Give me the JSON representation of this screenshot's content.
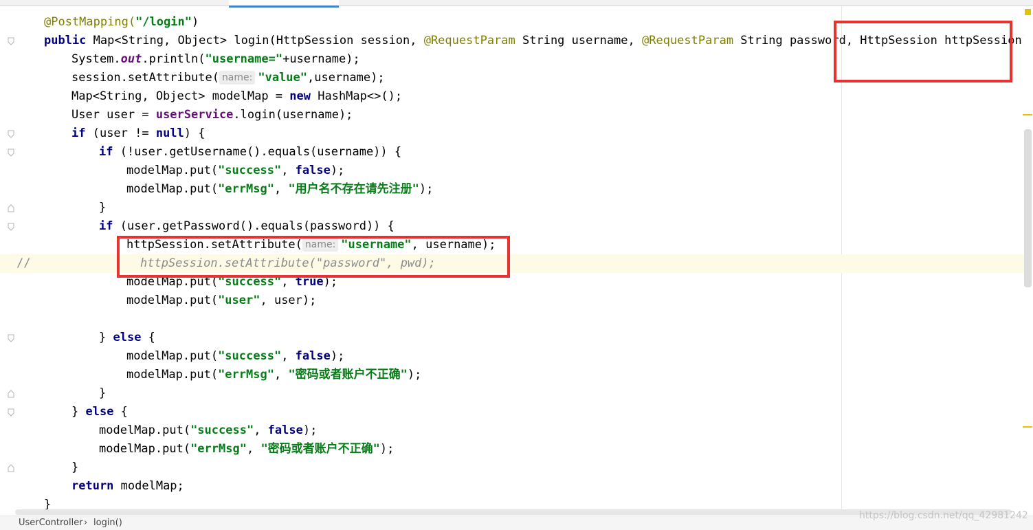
{
  "breadcrumb": {
    "class_name": "UserController",
    "separator": "›",
    "method": "login()"
  },
  "watermark": "https://blog.csdn.net/qq_42981242",
  "colors": {
    "accent_tab": "#4083c9",
    "annotation_box": "#e83232",
    "string": "#067d17",
    "keyword": "#000080"
  },
  "code_lines": [
    {
      "ann": "@PostMapping(",
      "str": "\"/login\"",
      "tail": ")"
    },
    {
      "kw": "public",
      "a": " Map<String, Object> login(HttpSession session, ",
      "ann1": "@RequestParam",
      "b": " String username, ",
      "ann2": "@RequestParam",
      "c": " String password, HttpSession httpSession) {"
    },
    {
      "a": "System.",
      "sfld": "out",
      "b": ".println(",
      "str": "\"username=\"",
      "c": "+username);"
    },
    {
      "a": "session.setAttribute(",
      "hint": "name:",
      "str": "\"value\"",
      "c": ",username);"
    },
    {
      "a": "Map<String, Object> modelMap = ",
      "kw": "new",
      "b": " HashMap<>();"
    },
    {
      "a": "User user = ",
      "fld": "userService",
      "b": ".login(username);"
    },
    {
      "kw": "if",
      "a": " (user != ",
      "kw2": "null",
      "b": ") {"
    },
    {
      "kw": "if",
      "a": " (!user.getUsername().equals(username)) {"
    },
    {
      "a": "modelMap.put(",
      "str": "\"success\"",
      "b": ", ",
      "kw": "false",
      "c": ");"
    },
    {
      "a": "modelMap.put(",
      "str": "\"errMsg\"",
      "b": ", ",
      "str2": "\"用户名不存在请先注册\"",
      "c": ");"
    },
    {
      "a": "}"
    },
    {
      "kw": "if",
      "a": " (user.getPassword().equals(password)) {"
    },
    {
      "a": "httpSession.setAttribute(",
      "hint": "name:",
      "str": "\"username\"",
      "c": ", username);"
    },
    {
      "prefix": "//",
      "cmt": "httpSession.setAttribute(\"password\", pwd);"
    },
    {
      "a": "modelMap.put(",
      "str": "\"success\"",
      "b": ", ",
      "kw": "true",
      "c": ");"
    },
    {
      "a": "modelMap.put(",
      "str": "\"user\"",
      "b": ", user);"
    },
    {
      "a": ""
    },
    {
      "a": "} ",
      "kw": "else",
      "b": " {"
    },
    {
      "a": "modelMap.put(",
      "str": "\"success\"",
      "b": ", ",
      "kw": "false",
      "c": ");"
    },
    {
      "a": "modelMap.put(",
      "str": "\"errMsg\"",
      "b": ", ",
      "str2": "\"密码或者账户不正确\"",
      "c": ");"
    },
    {
      "a": "}"
    },
    {
      "a": "} ",
      "kw": "else",
      "b": " {"
    },
    {
      "a": "modelMap.put(",
      "str": "\"success\"",
      "b": ", ",
      "kw": "false",
      "c": ");"
    },
    {
      "a": "modelMap.put(",
      "str": "\"errMsg\"",
      "b": ", ",
      "str2": "\"密码或者账户不正确\"",
      "c": ");"
    },
    {
      "a": "}"
    },
    {
      "kw": "return",
      "a": " modelMap;"
    },
    {
      "a": "}"
    }
  ]
}
